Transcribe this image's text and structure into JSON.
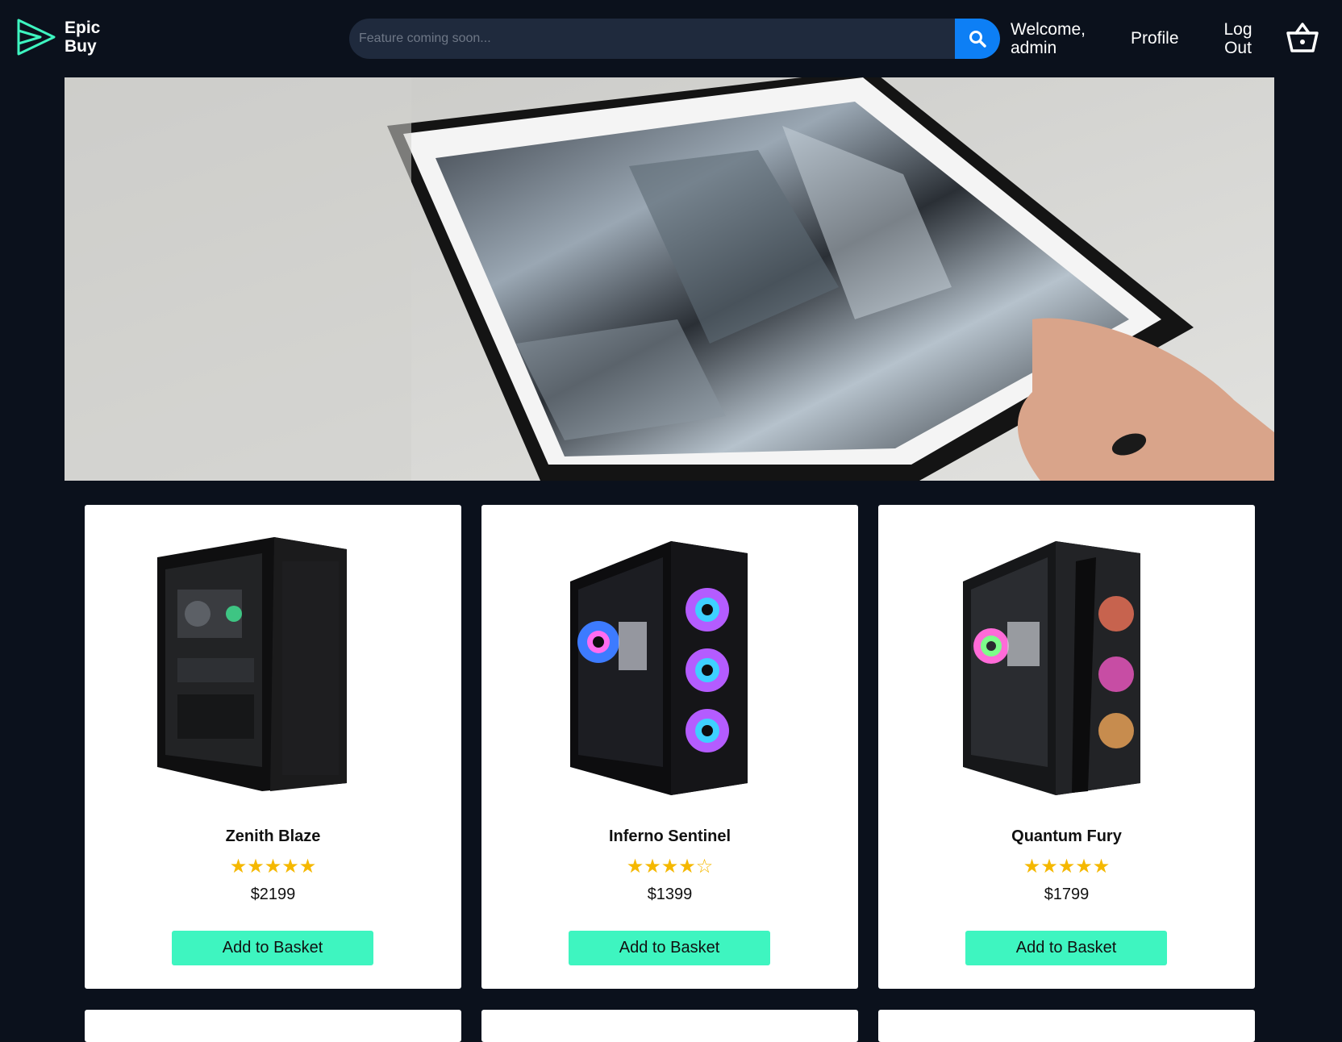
{
  "header": {
    "brand_line1": "Epic",
    "brand_line2": "Buy",
    "search_placeholder": "Feature coming soon...",
    "welcome_line1": "Welcome,",
    "welcome_line2": "admin",
    "profile_label": "Profile",
    "logout_line1": "Log",
    "logout_line2": "Out",
    "accent_color": "#3ef5c0",
    "search_button_color": "#0d7ff5"
  },
  "products": [
    {
      "name": "Zenith Blaze",
      "stars": "★★★★★",
      "rating": 5,
      "price": "$2199",
      "button": "Add to Basket"
    },
    {
      "name": "Inferno Sentinel",
      "stars": "★★★★☆",
      "rating": 4,
      "price": "$1399",
      "button": "Add to Basket"
    },
    {
      "name": "Quantum Fury",
      "stars": "★★★★★",
      "rating": 5,
      "price": "$1799",
      "button": "Add to Basket"
    }
  ]
}
